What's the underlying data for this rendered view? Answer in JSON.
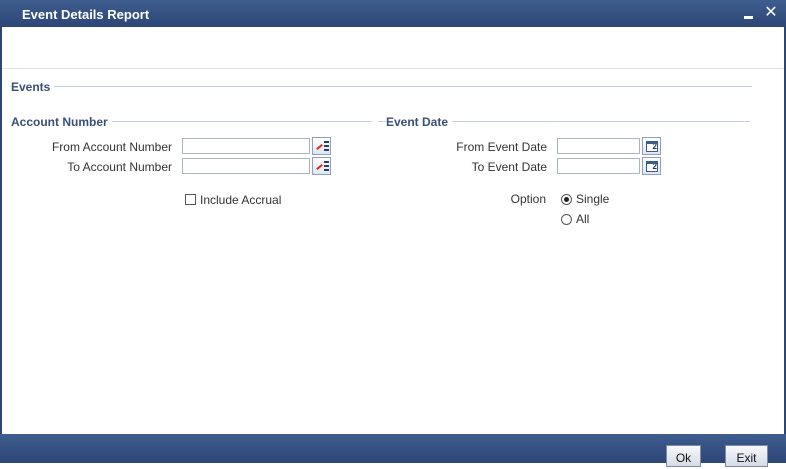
{
  "window": {
    "title": "Event Details Report",
    "minimize_symbol": "",
    "close_symbol": "✕"
  },
  "events_section": {
    "heading": "Events"
  },
  "account_section": {
    "heading": "Account Number",
    "from_label": "From Account Number",
    "from_value": "",
    "to_label": "To Account Number",
    "to_value": "",
    "include_accrual_label": "Include Accrual",
    "include_accrual_checked": false
  },
  "event_date_section": {
    "heading": "Event Date",
    "from_label": "From Event Date",
    "from_value": "",
    "to_label": "To Event Date",
    "to_value": "",
    "calendar_glyph": "2",
    "option_label": "Option",
    "options": [
      {
        "label": "Single",
        "selected": true
      },
      {
        "label": "All",
        "selected": false
      }
    ]
  },
  "footer": {
    "ok_label": "Ok",
    "exit_label": "Exit"
  },
  "colors": {
    "titlebar": "#2c4676",
    "section_heading": "#3a4f78",
    "error_accent": "#d92b1f"
  }
}
